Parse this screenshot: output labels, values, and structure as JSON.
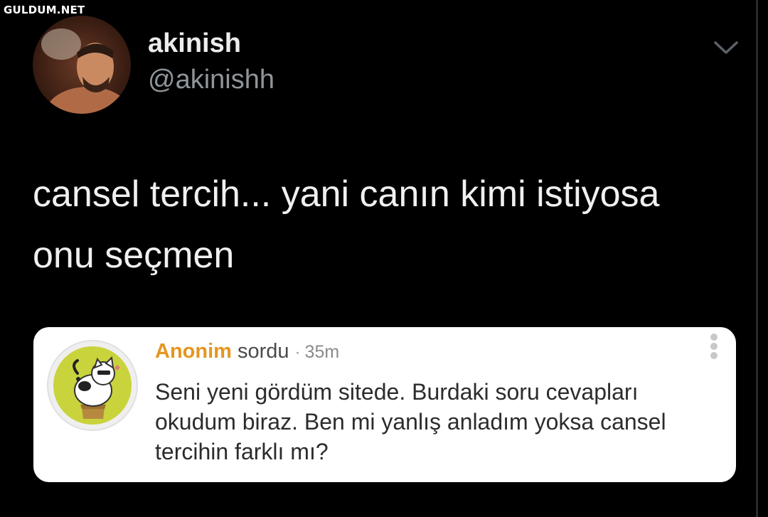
{
  "watermark": "GULDUM.NET",
  "tweet": {
    "display_name": "akinish",
    "handle": "@akinishh",
    "text_line1": "cansel tercih... yani canın kimi istiyosa",
    "text_line2": "onu seçmen",
    "menu_icon": "chevron-down-icon"
  },
  "card": {
    "asker": "Anonim",
    "verb": "sordu",
    "separator": "·",
    "time": "35m",
    "question_line1": "Seni yeni gördüm sitede. Burdaki soru cevapları",
    "question_line2": "okudum biraz. Ben mi yanlış anladım yoksa cansel",
    "question_line3": "tercihin farklı mı?",
    "more_icon": "vertical-dots-icon",
    "avatar_icon": "anonymous-cat-icon"
  },
  "colors": {
    "background": "#000000",
    "asker": "#e6951f",
    "card_bg": "#ffffff",
    "cat_circle": "#c9d33c"
  }
}
